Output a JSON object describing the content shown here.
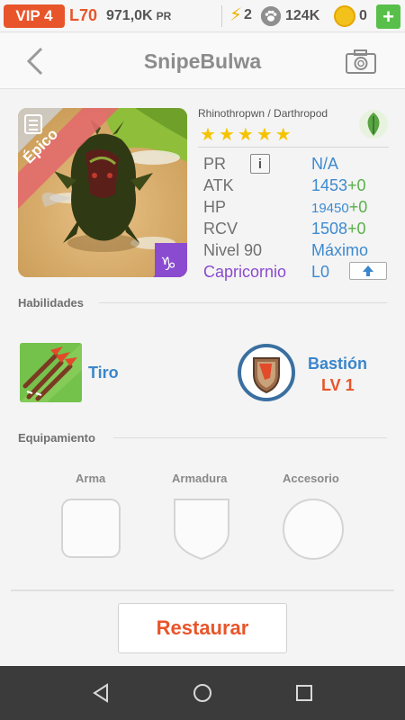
{
  "topbar": {
    "vip": "VIP 4",
    "level": "L70",
    "pr_value": "971,0K",
    "pr_unit": "PR",
    "energy": "2",
    "paws": "124K",
    "coins": "0"
  },
  "header": {
    "title": "SnipeBulwa"
  },
  "monster": {
    "rarity": "Épico",
    "species": "Rhinothropwn / Darthropod",
    "element_icon": "leaf-icon",
    "stars": 5
  },
  "stats": {
    "pr_label": "PR",
    "pr_value": "N/A",
    "atk_label": "ATK",
    "atk_value": "1453",
    "atk_bonus": "+0",
    "hp_label": "HP",
    "hp_value": "19450",
    "hp_bonus": "+0",
    "rcv_label": "RCV",
    "rcv_value": "1508",
    "rcv_bonus": "+0",
    "level_label": "Nivel 90",
    "level_value": "Máximo",
    "sign_label": "Capricornio",
    "sign_value": "L0"
  },
  "skills": {
    "title": "Habilidades",
    "skill1": "Tiro",
    "skill2": "Bastión",
    "skill2_level": "LV 1"
  },
  "equipment": {
    "title": "Equipamiento",
    "weapon": "Arma",
    "armor": "Armadura",
    "accessory": "Accesorio"
  },
  "actions": {
    "restore": "Restaurar"
  },
  "colors": {
    "accent": "#e8552a",
    "link_blue": "#3a86cc",
    "bonus_green": "#5ab04a",
    "capricorn_purple": "#8a4bd0"
  }
}
